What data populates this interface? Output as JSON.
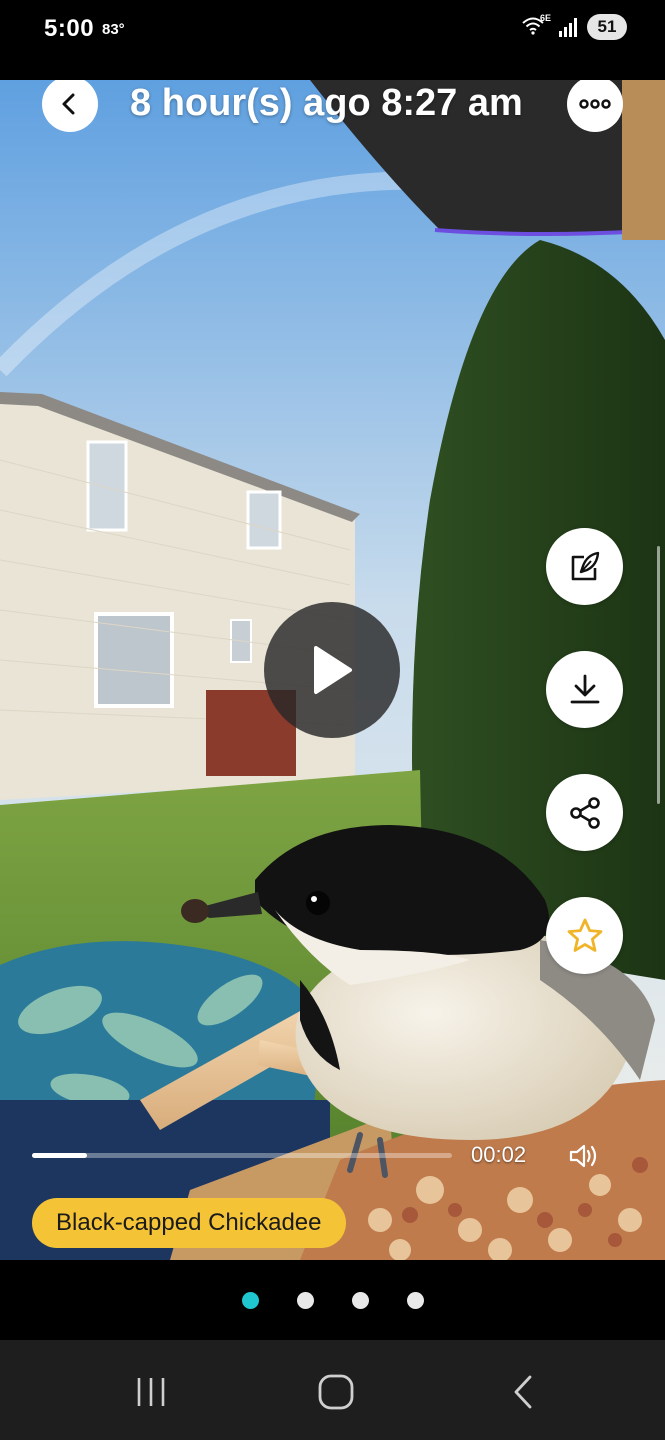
{
  "status_bar": {
    "time": "5:00",
    "temperature": "83°",
    "wifi_label": "6E",
    "battery": "51"
  },
  "video": {
    "title": "8 hour(s) ago 8:27 am",
    "elapsed": "00:02",
    "progress_fraction": 0.13,
    "species_label": "Black-capped Chickadee",
    "side_actions": [
      "edit-note",
      "download",
      "share",
      "favorite"
    ]
  },
  "pager": {
    "count": 4,
    "active_index": 0
  },
  "colors": {
    "species_pill": "#f5c436",
    "pager_active": "#1fc6cf",
    "star": "#f0b429"
  }
}
